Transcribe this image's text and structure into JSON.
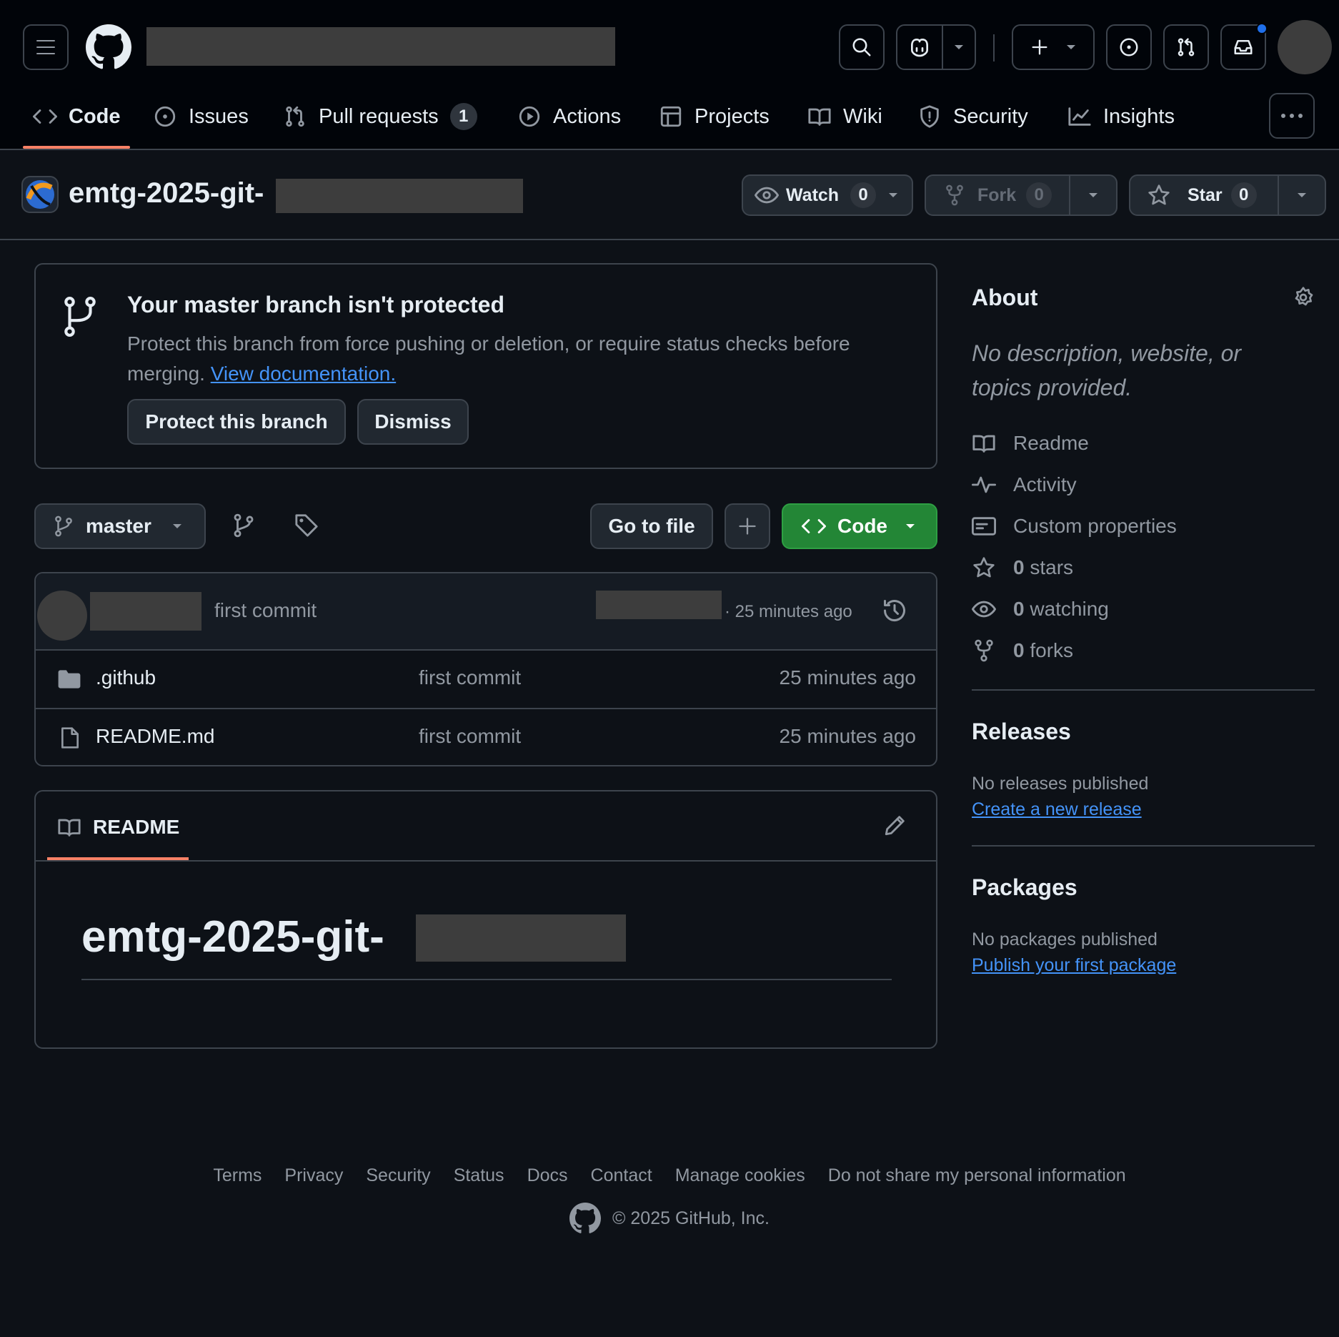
{
  "header": {
    "menu_icon": "hamburger-icon",
    "logo_icon": "github-logo-icon",
    "notification_dot_color": "#1f6feb"
  },
  "nav": {
    "tabs": [
      {
        "label": "Code",
        "icon": "code-icon",
        "selected": true
      },
      {
        "label": "Issues",
        "icon": "issue-icon"
      },
      {
        "label": "Pull requests",
        "icon": "pull-request-icon",
        "count": "1"
      },
      {
        "label": "Actions",
        "icon": "play-icon"
      },
      {
        "label": "Projects",
        "icon": "table-icon"
      },
      {
        "label": "Wiki",
        "icon": "book-icon"
      },
      {
        "label": "Security",
        "icon": "shield-icon"
      },
      {
        "label": "Insights",
        "icon": "graph-icon"
      }
    ],
    "more_icon": "kebab-icon"
  },
  "repo": {
    "name": "emtg-2025-git-",
    "watch": {
      "label": "Watch",
      "count": "0"
    },
    "fork": {
      "label": "Fork",
      "count": "0"
    },
    "star": {
      "label": "Star",
      "count": "0"
    }
  },
  "banner": {
    "title": "Your master branch isn't protected",
    "text": "Protect this branch from force pushing or deletion, or require status checks before merging.",
    "link": "View documentation.",
    "protect_button": "Protect this branch",
    "dismiss_button": "Dismiss"
  },
  "toolbar": {
    "branch": "master",
    "go_to_file": "Go to file",
    "add": "+",
    "code": "Code"
  },
  "commit": {
    "message": "first commit",
    "time": "· 25 minutes ago"
  },
  "files": [
    {
      "name": ".github",
      "type": "folder",
      "message": "first commit",
      "time": "25 minutes ago"
    },
    {
      "name": "README.md",
      "type": "file",
      "message": "first commit",
      "time": "25 minutes ago"
    }
  ],
  "readme": {
    "tab_label": "README",
    "heading": "emtg-2025-git-"
  },
  "about": {
    "title": "About",
    "description": "No description, website, or topics provided.",
    "items": [
      {
        "icon": "book-icon",
        "label": "Readme"
      },
      {
        "icon": "pulse-icon",
        "label": "Activity"
      },
      {
        "icon": "note-icon",
        "label": "Custom properties"
      },
      {
        "icon": "star-icon",
        "count": "0",
        "label": "stars"
      },
      {
        "icon": "eye-icon",
        "count": "0",
        "label": "watching"
      },
      {
        "icon": "fork-icon",
        "count": "0",
        "label": "forks"
      }
    ]
  },
  "releases": {
    "title": "Releases",
    "text": "No releases published",
    "link": "Create a new release"
  },
  "packages": {
    "title": "Packages",
    "text": "No packages published",
    "link": "Publish your first package"
  },
  "footer": {
    "links": [
      "Terms",
      "Privacy",
      "Security",
      "Status",
      "Docs",
      "Contact",
      "Manage cookies",
      "Do not share my personal information"
    ],
    "copyright": "© 2025 GitHub, Inc."
  }
}
